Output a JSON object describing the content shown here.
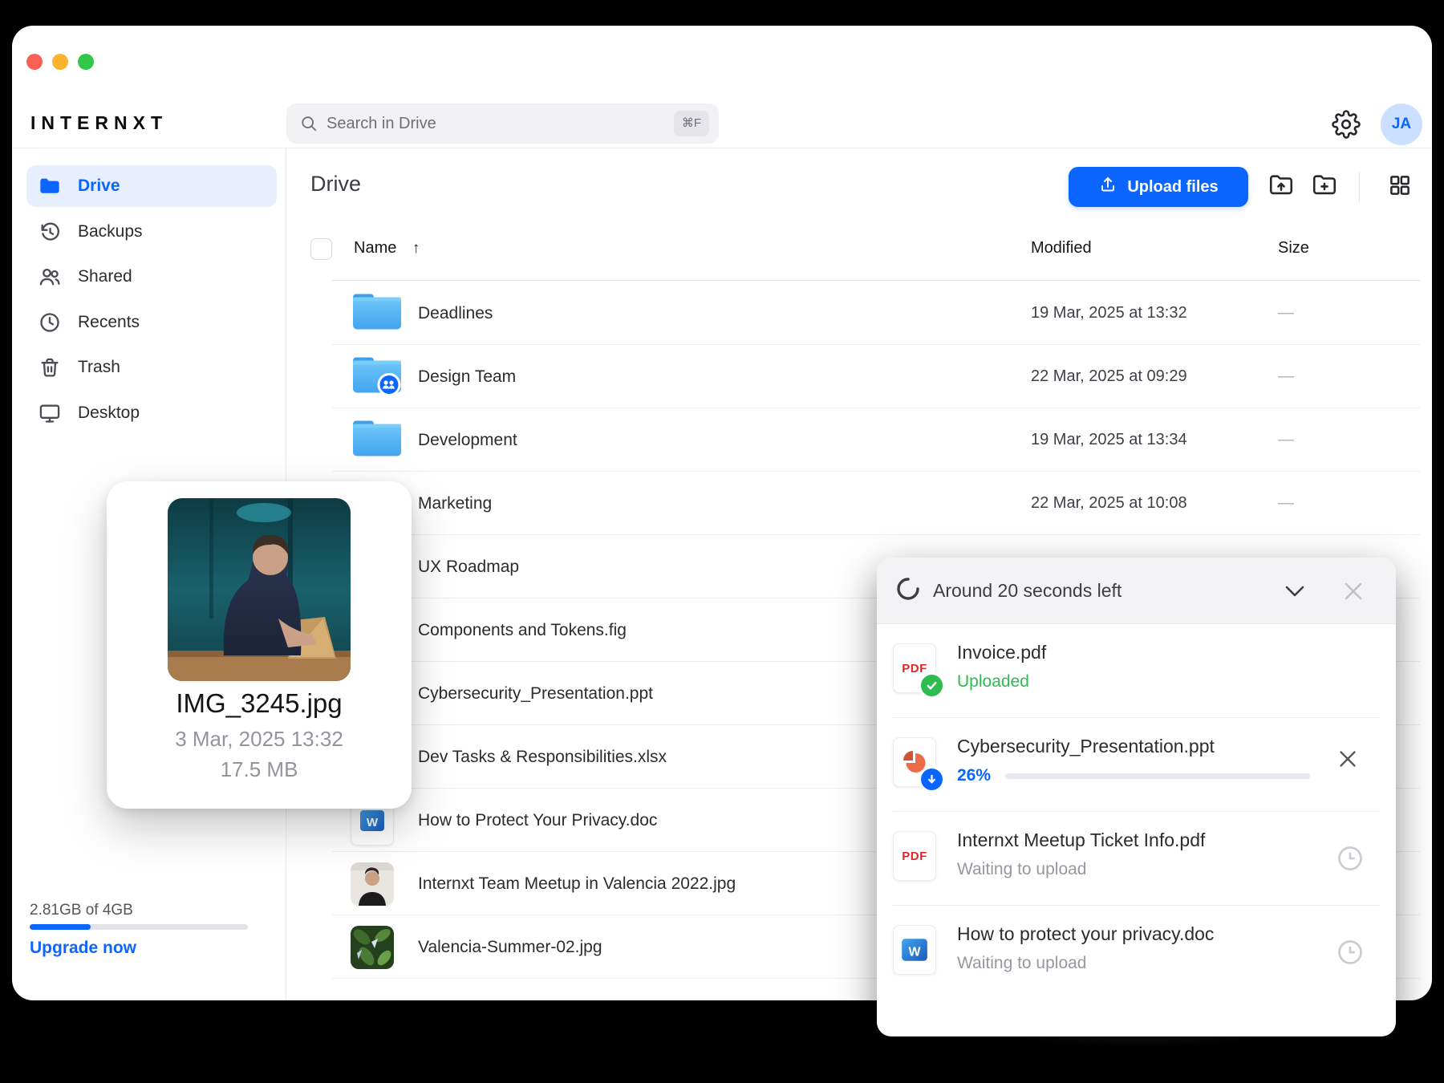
{
  "colors": {
    "accent": "#0b66ff",
    "green": "#2dbd4e",
    "muted_gray": "#94949c",
    "panel_header_bg": "#f3f3f6",
    "traffic_red": "#f96157",
    "traffic_yellow": "#f9b42c",
    "traffic_green": "#33c748"
  },
  "brand": {
    "logo": "INTERNXT"
  },
  "topbar": {
    "search_placeholder": "Search in Drive",
    "search_shortcut": "⌘F",
    "avatar_initials": "JA"
  },
  "sidebar": {
    "items": [
      {
        "label": "Drive",
        "icon": "drive-folder",
        "active": true
      },
      {
        "label": "Backups",
        "icon": "backups-history",
        "active": false
      },
      {
        "label": "Shared",
        "icon": "shared-users",
        "active": false
      },
      {
        "label": "Recents",
        "icon": "recents-clock",
        "active": false
      },
      {
        "label": "Trash",
        "icon": "trash",
        "active": false
      },
      {
        "label": "Desktop",
        "icon": "desktop-monitor",
        "active": false
      }
    ],
    "storage": {
      "usage_text": "2.81GB of 4GB",
      "bar_fraction": 0.28,
      "upgrade_label": "Upgrade now"
    }
  },
  "content": {
    "title": "Drive",
    "upload_button_label": "Upload files",
    "columns": {
      "name": "Name",
      "sort_arrow": "↑",
      "modified": "Modified",
      "size": "Size"
    },
    "rows": [
      {
        "name": "Deadlines",
        "icon": "folder",
        "modified": "19 Mar, 2025 at 13:32",
        "size": "—"
      },
      {
        "name": "Design Team",
        "icon": "folder-shared",
        "modified": "22 Mar, 2025 at 09:29",
        "size": "—"
      },
      {
        "name": "Development",
        "icon": "folder",
        "modified": "19 Mar, 2025 at 13:34",
        "size": "—"
      },
      {
        "name": "Marketing",
        "icon": "folder",
        "modified": "22 Mar, 2025 at 10:08",
        "size": "—"
      },
      {
        "name": "UX Roadmap",
        "icon": "folder",
        "modified": "",
        "size": ""
      },
      {
        "name": "Components and Tokens.fig",
        "icon": "fig",
        "modified": "",
        "size": ""
      },
      {
        "name": "Cybersecurity_Presentation.ppt",
        "icon": "ppt",
        "modified": "",
        "size": ""
      },
      {
        "name": "Dev Tasks & Responsibilities.xlsx",
        "icon": "xlsx",
        "modified": "",
        "size": ""
      },
      {
        "name": "How to Protect Your Privacy.doc",
        "icon": "doc",
        "modified": "",
        "size": ""
      },
      {
        "name": "Internxt Team Meetup in Valencia 2022.jpg",
        "icon": "photo-person",
        "modified": "",
        "size": ""
      },
      {
        "name": "Valencia-Summer-02.jpg",
        "icon": "photo-leaves",
        "modified": "",
        "size": ""
      }
    ]
  },
  "preview_card": {
    "filename": "IMG_3245.jpg",
    "date": "3 Mar, 2025 13:32",
    "size": "17.5 MB"
  },
  "upload_panel": {
    "title": "Around 20 seconds left",
    "items": [
      {
        "name": "Invoice.pdf",
        "type": "pdf",
        "state": "done",
        "status": "Uploaded"
      },
      {
        "name": "Cybersecurity_Presentation.ppt",
        "type": "ppt",
        "state": "uploading",
        "status": "26%",
        "progress_label": "26%",
        "progress_fraction": 0.3
      },
      {
        "name": "Internxt Meetup Ticket Info.pdf",
        "type": "pdf",
        "state": "waiting",
        "status": "Waiting to upload"
      },
      {
        "name": "How to protect your privacy.doc",
        "type": "doc",
        "state": "waiting",
        "status": "Waiting to upload"
      }
    ]
  }
}
